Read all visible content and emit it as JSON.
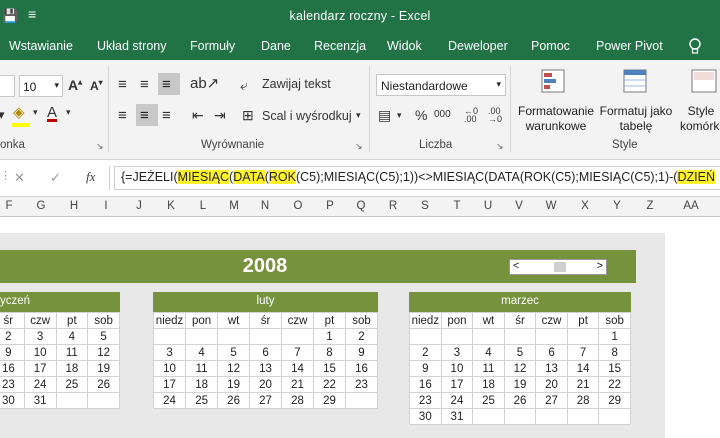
{
  "titlebar": {
    "save_icon": "💾",
    "customize_icon": "≡",
    "title": "kalendarz roczny  -  Excel"
  },
  "tabs": [
    "Wstawianie",
    "Układ strony",
    "Formuły",
    "Dane",
    "Recenzja",
    "Widok",
    "Deweloper",
    "Pomoc",
    "Power Pivot"
  ],
  "tell_me_icon": "lightbulb-icon",
  "ribbon": {
    "font_size": "10",
    "wrap_text": "Zawijaj tekst",
    "merge_center": "Scal i wyśrodkuj",
    "number_format": "Niestandardowe",
    "percent": "%",
    "thousands": "000",
    "conditional_format": [
      "Formatowanie",
      "warunkowe"
    ],
    "format_table": [
      "Formatuj jako",
      "tabelę"
    ],
    "cell_styles": [
      "Style",
      "komórki"
    ],
    "groups": {
      "font": "onka",
      "alignment": "Wyrównanie",
      "number": "Liczba",
      "styles": "Style"
    }
  },
  "formula_bar": {
    "cancel": "✕",
    "enter": "✓",
    "fx": "fx",
    "parts": [
      {
        "t": "{=JEŻELI(",
        "h": false
      },
      {
        "t": "MIESIĄC",
        "h": true
      },
      {
        "t": "(",
        "h": false
      },
      {
        "t": "DATA",
        "h": true
      },
      {
        "t": "(",
        "h": false
      },
      {
        "t": "ROK",
        "h": true
      },
      {
        "t": "(C5);MIESIĄC(C5);1))<>MIESIĄC(DATA(ROK(C5);MIESIĄC(C5);1)-(",
        "h": false
      },
      {
        "t": "DZIEŃ",
        "h": true
      }
    ]
  },
  "columns": [
    "F",
    "G",
    "H",
    "I",
    "J",
    "K",
    "L",
    "M",
    "N",
    "O",
    "P",
    "Q",
    "R",
    "S",
    "T",
    "U",
    "V",
    "W",
    "X",
    "Y",
    "Z",
    "AA"
  ],
  "calendar": {
    "year": "2008",
    "scroll_left": "<",
    "scroll_right": ">",
    "months": [
      {
        "name": "yczeń",
        "days": [
          "śr",
          "czw",
          "pt",
          "sob"
        ],
        "rows": [
          [
            "2",
            "3",
            "4",
            "5"
          ],
          [
            "9",
            "10",
            "11",
            "12"
          ],
          [
            "16",
            "17",
            "18",
            "19"
          ],
          [
            "23",
            "24",
            "25",
            "26"
          ],
          [
            "30",
            "31",
            "",
            ""
          ]
        ]
      },
      {
        "name": "luty",
        "days": [
          "niedz",
          "pon",
          "wt",
          "śr",
          "czw",
          "pt",
          "sob"
        ],
        "rows": [
          [
            "",
            "",
            "",
            "",
            "",
            "1",
            "2"
          ],
          [
            "3",
            "4",
            "5",
            "6",
            "7",
            "8",
            "9"
          ],
          [
            "10",
            "11",
            "12",
            "13",
            "14",
            "15",
            "16"
          ],
          [
            "17",
            "18",
            "19",
            "20",
            "21",
            "22",
            "23"
          ],
          [
            "24",
            "25",
            "26",
            "27",
            "28",
            "29",
            ""
          ]
        ]
      },
      {
        "name": "marzec",
        "days": [
          "niedz",
          "pon",
          "wt",
          "śr",
          "czw",
          "pt",
          "sob"
        ],
        "rows": [
          [
            "",
            "",
            "",
            "",
            "",
            "",
            "1"
          ],
          [
            "2",
            "3",
            "4",
            "5",
            "6",
            "7",
            "8"
          ],
          [
            "9",
            "10",
            "11",
            "12",
            "13",
            "14",
            "15"
          ],
          [
            "16",
            "17",
            "18",
            "19",
            "20",
            "21",
            "22"
          ],
          [
            "23",
            "24",
            "25",
            "26",
            "27",
            "28",
            "29"
          ],
          [
            "30",
            "31",
            "",
            "",
            "",
            "",
            ""
          ]
        ]
      }
    ]
  }
}
